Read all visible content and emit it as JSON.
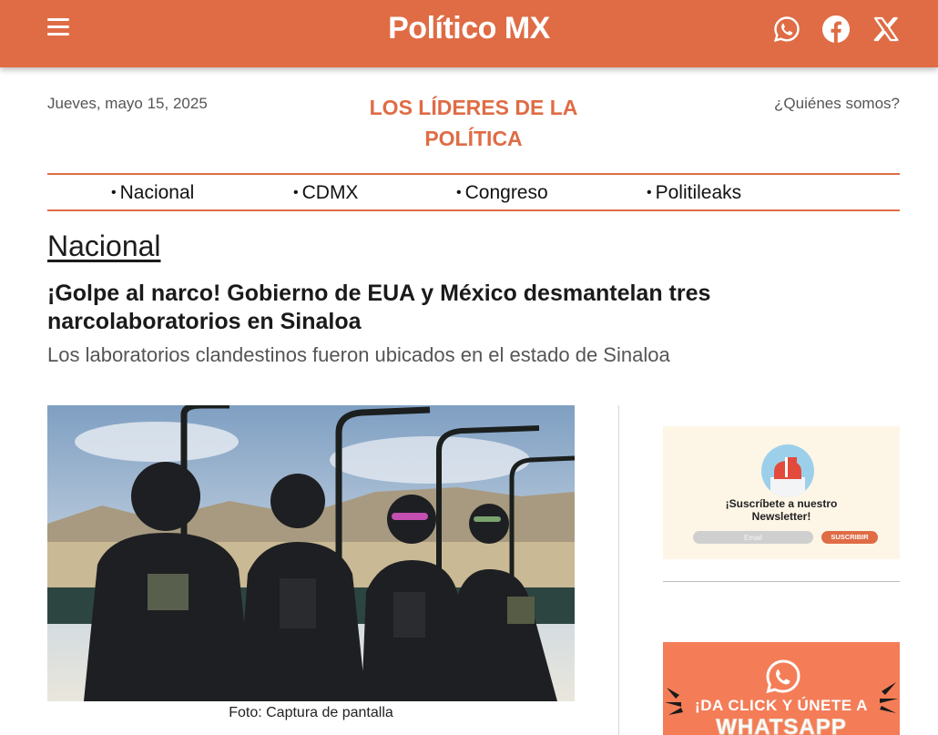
{
  "header": {
    "logo": "Político MX",
    "social": [
      {
        "name": "whatsapp",
        "icon": "whatsapp-icon"
      },
      {
        "name": "facebook",
        "icon": "facebook-icon"
      },
      {
        "name": "x",
        "icon": "x-icon"
      }
    ],
    "menu_icon": "hamburger-icon",
    "bar_color": "#df6c45"
  },
  "top": {
    "date": "Jueves, mayo 15, 2025",
    "tagline_line1": "LOS LÍDERES DE LA",
    "tagline_line2": "POLÍTICA",
    "about": "¿Quiénes somos?"
  },
  "nav": {
    "items": [
      "Nacional",
      "CDMX",
      "Congreso",
      "Politileaks"
    ]
  },
  "article": {
    "section": "Nacional",
    "headline": "¡Golpe al narco! Gobierno de EUA y México desmantelan tres narcolaboratorios en Sinaloa",
    "subhead": "Los laboratorios clandestinos fueron ubicados en el estado de Sinaloa",
    "caption": "Foto: Captura de pantalla"
  },
  "sidebar": {
    "newsletter": {
      "title_line1": "¡Suscríbete a nuestro",
      "title_line2": "Newsletter!",
      "email_placeholder": "Email",
      "button": "SUSCRIBIR"
    },
    "whatsapp_banner": {
      "line1": "¡DA CLICK Y ÚNETE A",
      "line2": "WHATSAPP"
    }
  },
  "colors": {
    "accent": "#df6c45",
    "banner": "#f47d58",
    "newsletter_bg": "#fdf6e6"
  }
}
